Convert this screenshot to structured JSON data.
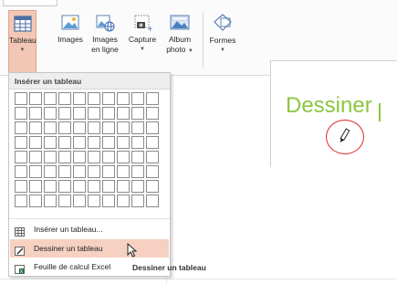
{
  "ribbon": {
    "buttons": [
      {
        "label_line1": "Tableau",
        "label_line2": "",
        "icon": "table-icon",
        "active": true
      },
      {
        "label_line1": "Images",
        "label_line2": "",
        "icon": "pictures-icon"
      },
      {
        "label_line1": "Images",
        "label_line2": "en ligne",
        "icon": "online-pictures-icon"
      },
      {
        "label_line1": "Capture",
        "label_line2": "",
        "icon": "screenshot-icon"
      },
      {
        "label_line1": "Album",
        "label_line2": "photo",
        "icon": "photo-album-icon"
      },
      {
        "label_line1": "Formes",
        "label_line2": "",
        "icon": "shapes-icon"
      }
    ]
  },
  "slide": {
    "title_text": "Dessiner"
  },
  "table_menu": {
    "header": "Insérer un tableau",
    "grid_rows": 8,
    "grid_cols": 10,
    "items": [
      {
        "label": "Insérer un tableau...",
        "icon": "insert-table-icon"
      },
      {
        "label": "Dessiner un tableau",
        "icon": "draw-table-icon",
        "highlighted": true
      },
      {
        "label": "Feuille de calcul Excel",
        "icon": "excel-spreadsheet-icon"
      }
    ]
  },
  "tooltip": {
    "text": "Dessiner un tableau"
  },
  "colors": {
    "accent_highlight": "#f2c7b6",
    "title_green": "#8cc63f",
    "annotation_red": "#e02424"
  }
}
